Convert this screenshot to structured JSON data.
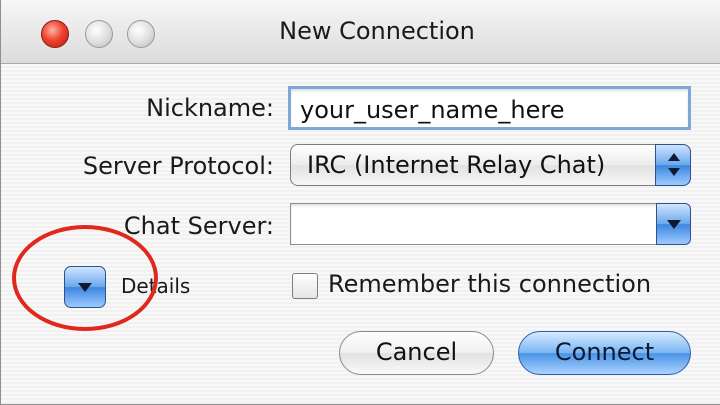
{
  "window": {
    "title": "New Connection"
  },
  "form": {
    "nickname_label": "Nickname:",
    "nickname_value": "your_user_name_here",
    "protocol_label": "Server Protocol:",
    "protocol_value": "IRC (Internet Relay Chat)",
    "server_label": "Chat Server:",
    "server_value": "",
    "details_label": "Details",
    "remember_label": "Remember this connection",
    "remember_checked": false
  },
  "buttons": {
    "cancel_label": "Cancel",
    "connect_label": "Connect"
  },
  "colors": {
    "annotation_circle": "#e0291d",
    "default_button": "#4b93e6"
  }
}
